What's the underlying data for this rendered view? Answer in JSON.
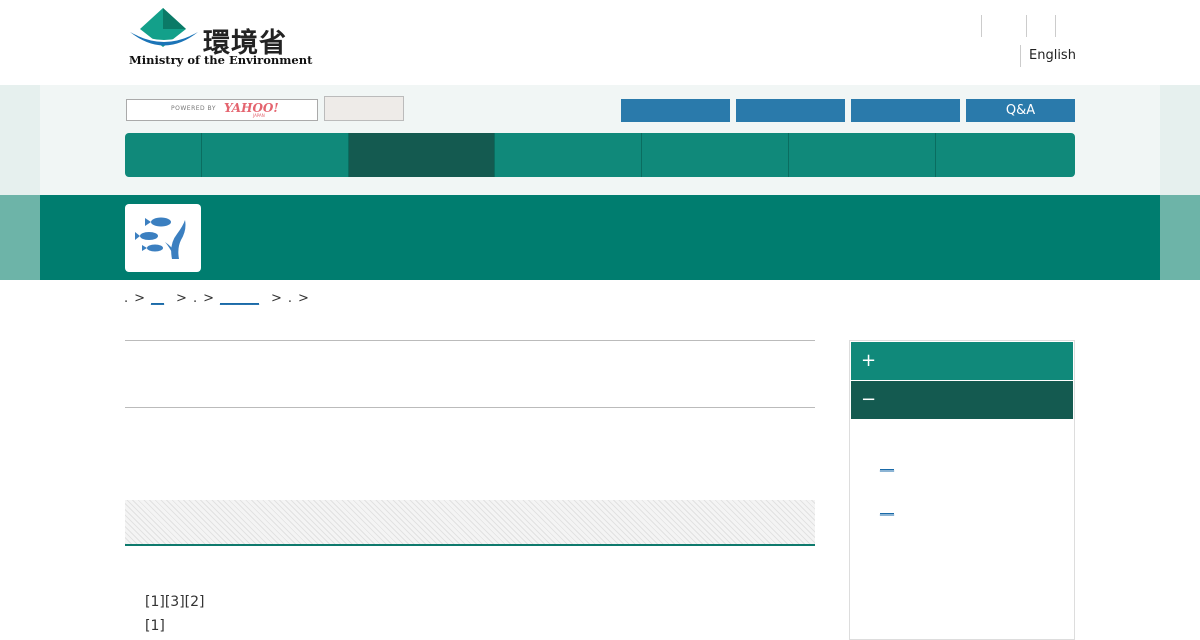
{
  "header": {
    "logo_kanji": "環境省",
    "logo_english": "Ministry of the Environment",
    "language_link": "English"
  },
  "search": {
    "powered_by": "POWERED BY",
    "provider": "YAHOO!",
    "provider_sub": "JAPAN",
    "button_label": ""
  },
  "quick_links": [
    "",
    "",
    "",
    "Q&A"
  ],
  "main_menu_count": 7,
  "breadcrumb": {
    "sep": ">",
    "items": [
      ".",
      "__",
      ".",
      "______",
      ".",
      ""
    ]
  },
  "content": {
    "lines": [
      "[1][3][2]",
      "[1]"
    ]
  },
  "sidebar": {
    "expand_symbol": "+",
    "collapse_symbol": "−",
    "links": [
      "__",
      "__"
    ]
  },
  "colors": {
    "brand_green": "#007d6f",
    "menu_green": "#10897a",
    "menu_active": "#145a50",
    "link_blue": "#2a7aab"
  }
}
